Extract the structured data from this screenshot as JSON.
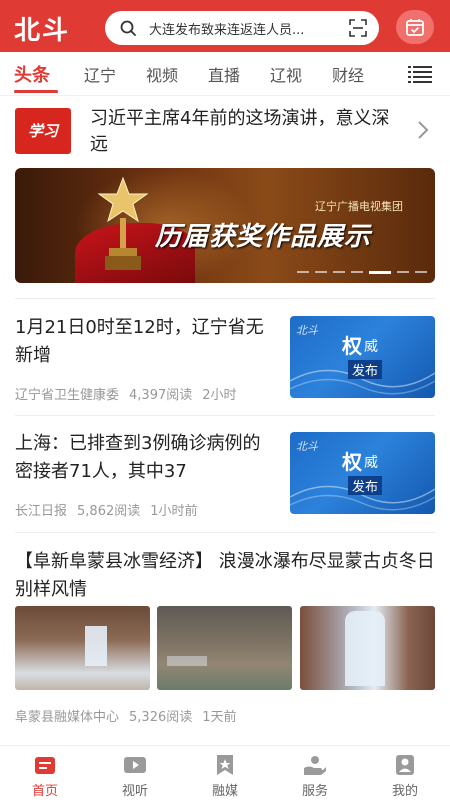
{
  "header": {
    "logo": "北斗",
    "search_text": "大连发布致来连返连人员...",
    "icons": [
      "search-icon",
      "scan-icon",
      "calendar-check-icon"
    ]
  },
  "nav": {
    "tabs": [
      {
        "label": "头条",
        "active": true
      },
      {
        "label": "辽宁",
        "active": false
      },
      {
        "label": "视频",
        "active": false
      },
      {
        "label": "直播",
        "active": false
      },
      {
        "label": "辽视",
        "active": false
      },
      {
        "label": "财经",
        "active": false
      }
    ],
    "menu_icon": "menu-icon"
  },
  "feature": {
    "badge": "学习",
    "title": "习近平主席4年前的这场演讲，意义深远"
  },
  "banner": {
    "org": "辽宁广播电视集团",
    "title": "历届获奖作品展示",
    "slide_count": 7,
    "active_slide": 5
  },
  "news": [
    {
      "title": "1月21日0时至12时，辽宁省无新增",
      "source": "辽宁省卫生健康委",
      "reads": "4,397阅读",
      "time": "2小时",
      "thumb_watermark": "北斗",
      "thumb_text_1": "权",
      "thumb_text_2": "威",
      "thumb_text_3": "发布"
    },
    {
      "title": "上海：已排查到3例确诊病例的密接者71人，其中37",
      "source": "长江日报",
      "reads": "5,862阅读",
      "time": "1小时前",
      "thumb_watermark": "北斗",
      "thumb_text_1": "权",
      "thumb_text_2": "威",
      "thumb_text_3": "发布"
    }
  ],
  "gallery_item": {
    "title": "【阜新阜蒙县冰雪经济】 浪漫冰瀑布尽显蒙古贞冬日别样风情",
    "source": "阜蒙县融媒体中心",
    "reads": "5,326阅读",
    "time": "1天前"
  },
  "bottom_nav": [
    {
      "label": "首页",
      "icon": "home-news-icon",
      "active": true
    },
    {
      "label": "视听",
      "icon": "video-play-icon",
      "active": false
    },
    {
      "label": "融媒",
      "icon": "bookmark-star-icon",
      "active": false
    },
    {
      "label": "服务",
      "icon": "service-hand-icon",
      "active": false
    },
    {
      "label": "我的",
      "icon": "profile-icon",
      "active": false
    }
  ],
  "colors": {
    "brand_red": "#e03a35",
    "thumb_blue": "#1d6cc8",
    "meta_gray": "#999999"
  }
}
